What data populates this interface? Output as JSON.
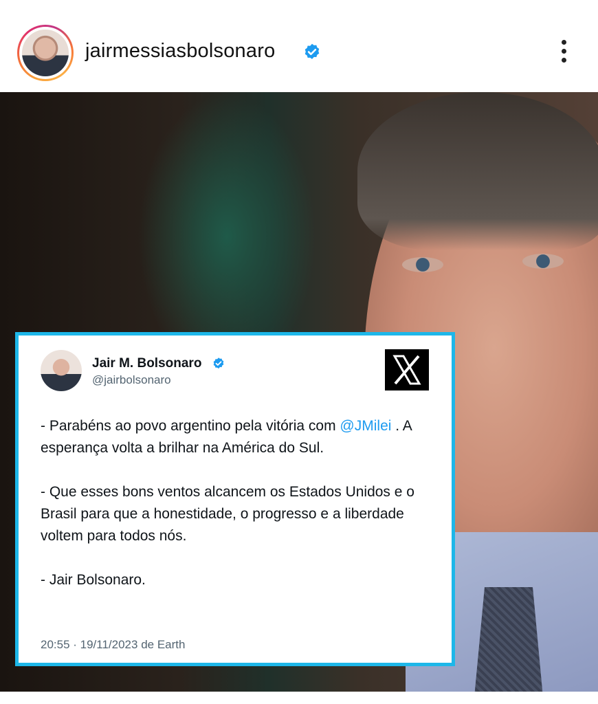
{
  "header": {
    "username": "jairmessiasbolsonaro",
    "more_icon": "more-vertical-icon"
  },
  "tweet": {
    "name": "Jair M. Bolsonaro",
    "handle": "@jairbolsonaro",
    "para1_before": "- Parabéns ao povo argentino pela vitória com ",
    "mention": "@JMilei",
    "para1_after": " . A esperança volta a brilhar na América do Sul.",
    "para2": "- Que esses bons ventos alcancem os Estados Unidos e o Brasil para que a honestidade, o progresso e a liberdade voltem para todos nós.",
    "para3": "- Jair Bolsonaro.",
    "timestamp": "20:55 · 19/11/2023 de Earth"
  },
  "colors": {
    "card_border": "#1db7e9",
    "mention": "#1d9bf0",
    "verified": "#1d9bf0"
  }
}
